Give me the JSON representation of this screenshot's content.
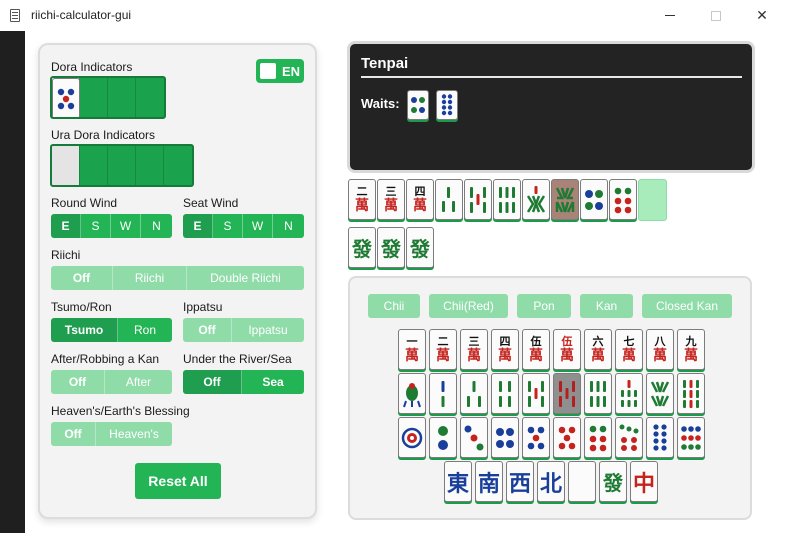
{
  "window": {
    "title": "riichi-calculator-gui",
    "min_icon": "minimize-icon",
    "max_icon": "maximize-icon",
    "close_icon": "close-icon",
    "close_glyph": "✕"
  },
  "settings": {
    "dora_label": "Dora Indicators",
    "ura_dora_label": "Ura Dora Indicators",
    "language_toggle": "EN",
    "round_wind": {
      "label": "Round Wind",
      "options": [
        "E",
        "S",
        "W",
        "N"
      ],
      "selected": "E"
    },
    "seat_wind": {
      "label": "Seat Wind",
      "options": [
        "E",
        "S",
        "W",
        "N"
      ],
      "selected": "E"
    },
    "riichi": {
      "label": "Riichi",
      "options": [
        "Off",
        "Riichi",
        "Double Riichi"
      ],
      "selected": "Off"
    },
    "tsumo_ron": {
      "label": "Tsumo/Ron",
      "options": [
        "Tsumo",
        "Ron"
      ],
      "selected": "Tsumo"
    },
    "ippatsu": {
      "label": "Ippatsu",
      "options": [
        "Off",
        "Ippatsu"
      ],
      "selected": "Off"
    },
    "after_kan": {
      "label": "After/Robbing a Kan",
      "options": [
        "Off",
        "After"
      ],
      "selected": "Off"
    },
    "under_river": {
      "label": "Under the River/Sea",
      "options": [
        "Off",
        "Sea"
      ],
      "selected": "Off"
    },
    "blessing": {
      "label": "Heaven's/Earth's Blessing",
      "options": [
        "Off",
        "Heaven's"
      ],
      "selected": "Off"
    },
    "reset_label": "Reset All"
  },
  "status": {
    "title": "Tenpai",
    "waits_label": "Waits:"
  },
  "hand": {
    "tiles": [
      "二萬",
      "三萬",
      "四萬",
      "3 Sou",
      "5 Sou",
      "6 Sou",
      "7 Sou",
      "8 Sou",
      "4 Pin",
      "6 Pin"
    ],
    "melds": [
      "發",
      "發",
      "發"
    ]
  },
  "picker": {
    "call_buttons": [
      "Chii",
      "Chii(Red)",
      "Pon",
      "Kan",
      "Closed Kan"
    ],
    "man": [
      {
        "n": "一",
        "m": "萬"
      },
      {
        "n": "二",
        "m": "萬"
      },
      {
        "n": "三",
        "m": "萬"
      },
      {
        "n": "四",
        "m": "萬"
      },
      {
        "n": "伍",
        "m": "萬"
      },
      {
        "n": "伍",
        "m": "萬"
      },
      {
        "n": "六",
        "m": "萬"
      },
      {
        "n": "七",
        "m": "萬"
      },
      {
        "n": "八",
        "m": "萬"
      },
      {
        "n": "九",
        "m": "萬"
      }
    ],
    "honors": [
      "東",
      "南",
      "西",
      "北",
      "",
      "發",
      "中"
    ]
  },
  "colors": {
    "accent": "#22b455",
    "accent_dark": "#1e9e4e",
    "accent_light": "#8fdca9",
    "status_bg": "#232323"
  }
}
